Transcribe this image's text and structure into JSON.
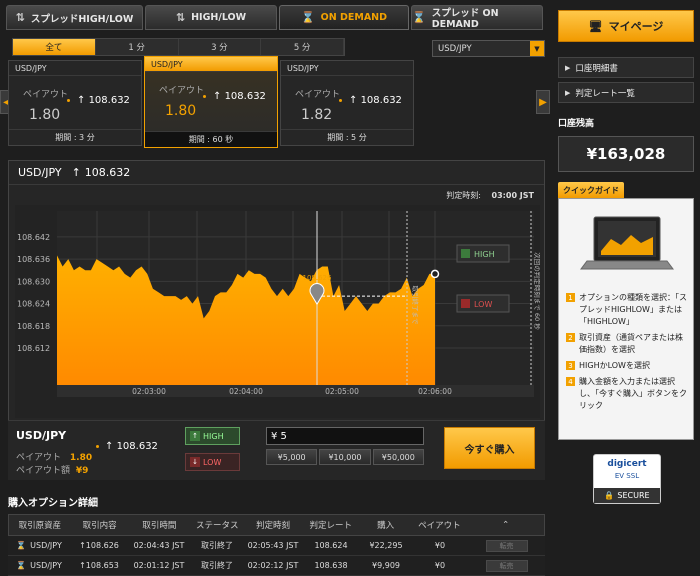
{
  "tabs": [
    {
      "label": "スプレッドHIGH/LOW",
      "icon": "spread-arrows-icon",
      "active": false
    },
    {
      "label": "HIGH/LOW",
      "icon": "updown-arrows-icon",
      "active": false
    },
    {
      "label": "ON DEMAND",
      "icon": "hourglass-icon",
      "active": true
    },
    {
      "label": "スプレッド ON DEMAND",
      "icon": "hourglass-icon",
      "active": false
    }
  ],
  "periods": [
    "全て",
    "1 分",
    "3 分",
    "5 分"
  ],
  "asset_select": {
    "value": "USD/JPY"
  },
  "cards": [
    {
      "asset": "USD/JPY",
      "payout_label": "ペイアウト",
      "payout": "1.80",
      "rate": "108.632",
      "period": "期間 : 3 分"
    },
    {
      "asset": "USD/JPY",
      "payout_label": "ペイアウト",
      "payout": "1.80",
      "rate": "108.632",
      "period": "期間 : 60 秒"
    },
    {
      "asset": "USD/JPY",
      "payout_label": "ペイアウト",
      "payout": "1.82",
      "rate": "108.632",
      "period": "期間 : 5 分"
    }
  ],
  "chart_panel": {
    "asset": "USD/JPY",
    "rate": "108.632",
    "judge_label": "判定時刻:",
    "judge_time": "03:00 JST",
    "high_label": "HIGH",
    "low_label": "LOW",
    "entry_label": "108.626",
    "side_label_1": "取引終了まで",
    "side_label_2": "次回の判定時刻まで 60 秒"
  },
  "chart_data": {
    "type": "area",
    "x_ticks": [
      "02:03:00",
      "02:04:00",
      "02:05:00",
      "02:06:00"
    ],
    "y_ticks": [
      108.642,
      108.636,
      108.63,
      108.624,
      108.618,
      108.612
    ],
    "ylim": [
      108.602,
      108.649
    ],
    "series": [
      {
        "values": [
          108.637,
          108.634,
          108.636,
          108.633,
          108.634,
          108.633,
          108.633,
          108.636,
          108.635,
          108.634,
          108.633,
          108.634,
          108.632,
          108.631,
          108.633,
          108.634,
          108.632,
          108.628,
          108.627,
          108.626,
          108.626,
          108.626,
          108.625,
          108.626,
          108.624,
          108.626,
          108.62,
          108.622,
          108.626,
          108.627,
          108.627,
          108.629,
          108.632,
          108.631,
          108.633,
          108.632,
          108.632,
          108.631,
          108.628,
          108.626,
          108.628,
          108.626,
          108.628,
          108.632,
          108.631,
          108.63,
          108.633,
          108.634,
          108.634,
          108.626,
          108.629,
          108.622,
          108.624,
          108.626,
          108.624,
          108.622,
          108.624,
          108.624,
          108.626,
          108.627,
          108.627,
          108.628,
          108.631,
          108.626,
          108.628,
          108.629,
          108.632,
          108.632
        ]
      }
    ],
    "strike": 108.626,
    "current": 108.632
  },
  "trade": {
    "asset": "USD/JPY",
    "rate": "108.632",
    "payout_label": "ペイアウト",
    "payout": "1.80",
    "payout_amount_label": "ペイアウト額",
    "payout_amount": "¥9",
    "high_label": "HIGH",
    "low_label": "LOW",
    "amount_value": "¥ 5",
    "quick_amounts": [
      "¥5,000",
      "¥10,000",
      "¥50,000"
    ],
    "buy_label": "今すぐ購入"
  },
  "details": {
    "title": "購入オプション詳細",
    "columns": [
      "取引原資産",
      "取引内容",
      "取引時間",
      "ステータス",
      "判定時刻",
      "判定レート",
      "購入",
      "ペイアウト"
    ],
    "rows": [
      {
        "asset": "USD/JPY",
        "content": "108.626",
        "time": "02:04:43 JST",
        "status": "取引終了",
        "judge_time": "02:05:43 JST",
        "judge_rate": "108.624",
        "buy": "¥22,295",
        "payout": "¥0",
        "action": "転売"
      },
      {
        "asset": "USD/JPY",
        "content": "108.653",
        "time": "02:01:12 JST",
        "status": "取引終了",
        "judge_time": "02:02:12 JST",
        "judge_rate": "108.638",
        "buy": "¥9,909",
        "payout": "¥0",
        "action": "転売"
      }
    ]
  },
  "sidebar": {
    "mypage_label": "マイページ",
    "menu": [
      "口座明細書",
      "判定レート一覧"
    ],
    "balance_label": "口座残高",
    "balance": "¥163,028",
    "guide_tab": "クイックガイド",
    "guide_items": [
      "オプションの種類を選択：「スプレッドHIGHLOW」または「HIGHLOW」",
      "取引資産（通貨ペアまたは株価指数）を選択",
      "HIGHかLOWを選択",
      "購入金額を入力または選択し、「今すぐ購入」ボタンをクリック"
    ]
  },
  "badge": {
    "brand": "digicert",
    "sub": "EV SSL",
    "secure": "SECURE"
  },
  "colors": {
    "accent": "#f2a100",
    "high": "#5fa05f",
    "low": "#e04040"
  }
}
